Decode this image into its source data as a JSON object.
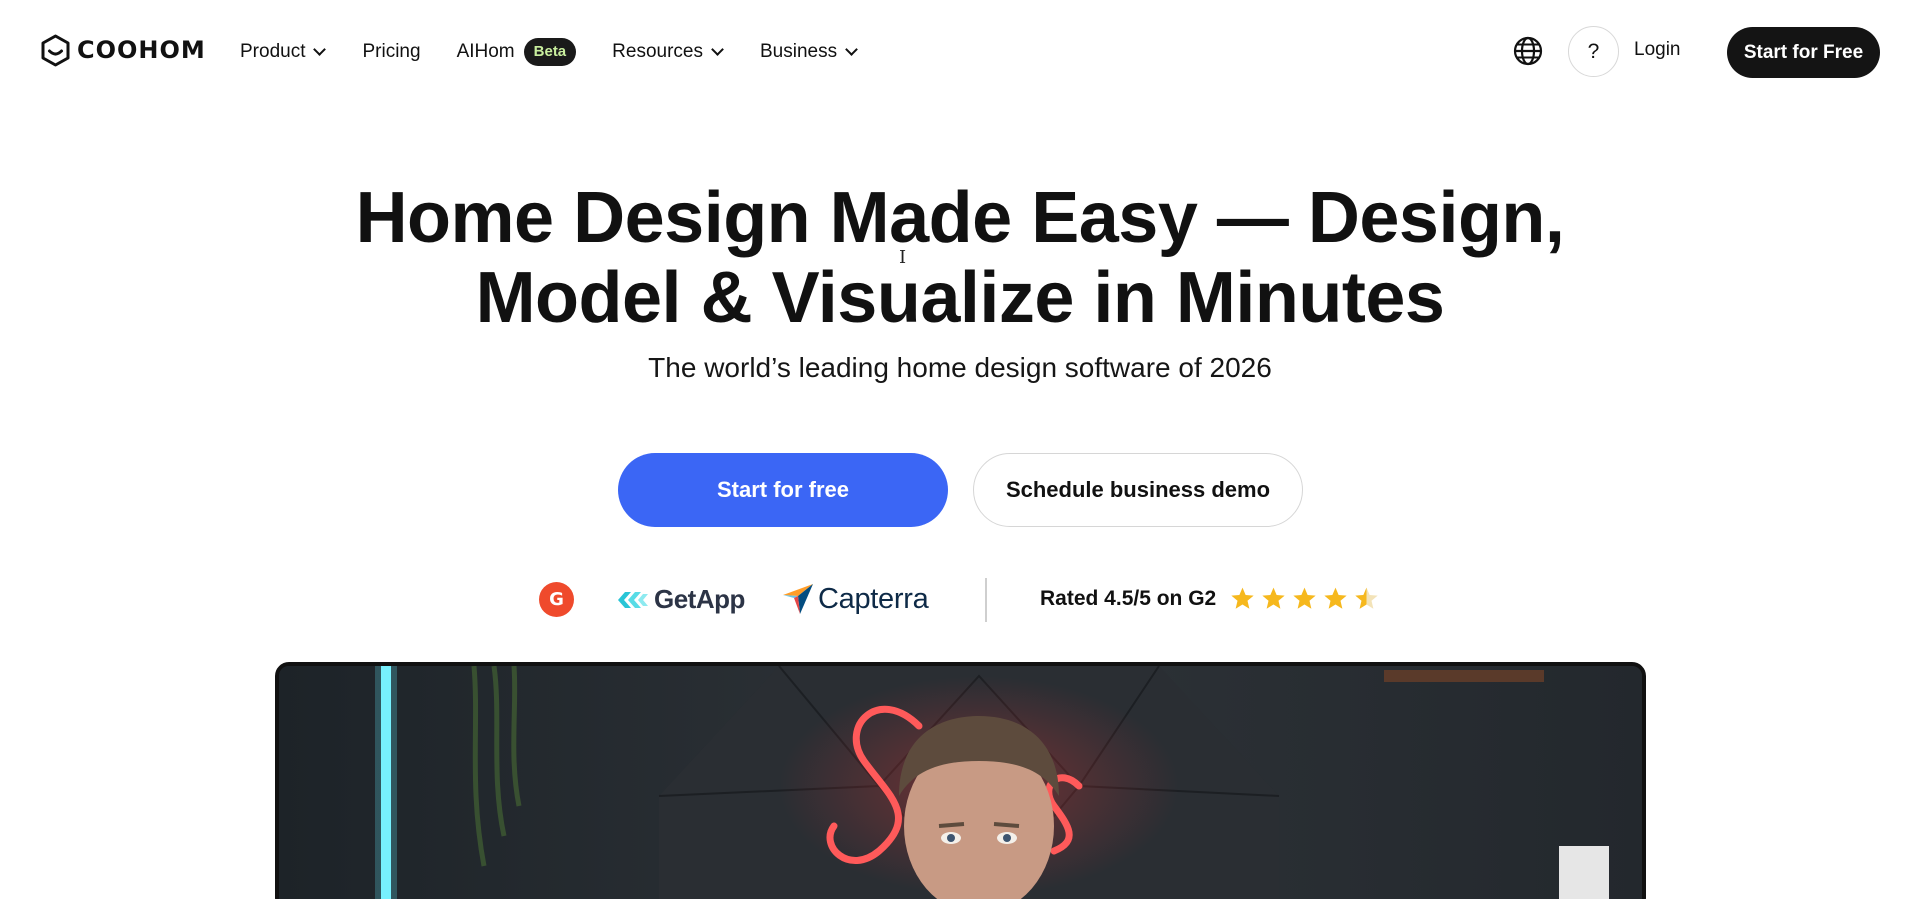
{
  "brand": {
    "name": "COOHOM"
  },
  "nav": {
    "items": [
      {
        "label": "Product",
        "dropdown": true
      },
      {
        "label": "Pricing",
        "dropdown": false
      },
      {
        "label": "AIHom",
        "badge": "Beta",
        "dropdown": false
      },
      {
        "label": "Resources",
        "dropdown": true
      },
      {
        "label": "Business",
        "dropdown": true
      }
    ]
  },
  "header_actions": {
    "language_icon": "globe-icon",
    "help_label": "?",
    "login_label": "Login",
    "start_label": "Start for Free"
  },
  "hero": {
    "title_line1": "Home Design Made Easy — Design,",
    "title_line2": "Model & Visualize in Minutes",
    "subtitle": "The world’s leading home design software of 2026",
    "primary_cta": "Start for free",
    "secondary_cta": "Schedule business demo"
  },
  "ratings": {
    "logos": [
      "G2",
      "GetApp",
      "Capterra"
    ],
    "rated_text": "Rated 4.5/5 on G2",
    "stars": 4.5,
    "star_color": "#f6b81d"
  },
  "colors": {
    "primary_blue": "#3b66f5",
    "dark": "#141414",
    "beta_text": "#c9ef9e",
    "g2_red": "#ef4a2c"
  },
  "video": {
    "icon": "video-preview"
  }
}
